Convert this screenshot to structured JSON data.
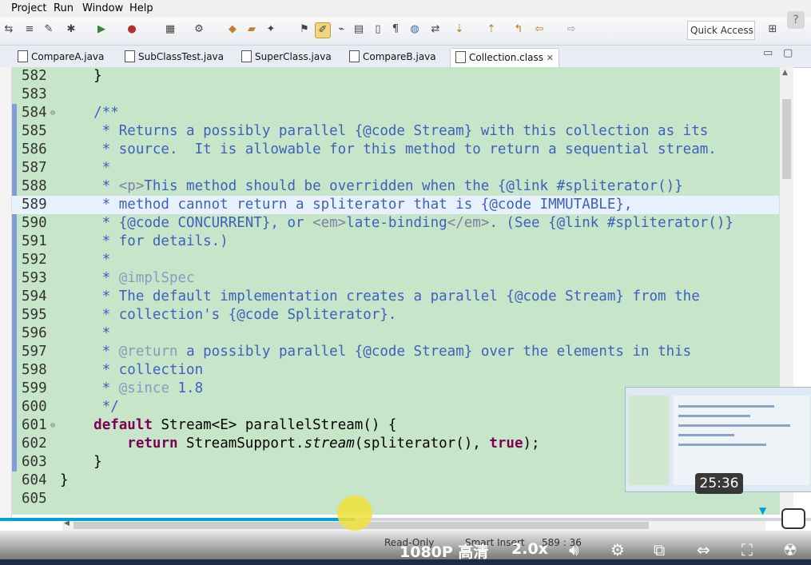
{
  "menu": {
    "items": [
      "Project",
      "Run",
      "Window",
      "Help"
    ]
  },
  "toolbar": {
    "quick_access": "Quick Access"
  },
  "tabs": [
    {
      "label": "CompareA.java"
    },
    {
      "label": "SubClassTest.java"
    },
    {
      "label": "SuperClass.java"
    },
    {
      "label": "CompareB.java"
    },
    {
      "label": "Collection.class",
      "active": true,
      "close": "✕"
    }
  ],
  "editor": {
    "highlighted_line": 589,
    "lines": [
      {
        "n": "582",
        "text": "    }"
      },
      {
        "n": "583",
        "text": ""
      },
      {
        "n": "584",
        "text": "    /**"
      },
      {
        "n": "585",
        "text": "     * Returns a possibly parallel {@code Stream} with this collection as its"
      },
      {
        "n": "586",
        "text": "     * source.  It is allowable for this method to return a sequential stream."
      },
      {
        "n": "587",
        "text": "     *"
      },
      {
        "n": "588",
        "text": "     * <p>This method should be overridden when the {@link #spliterator()}"
      },
      {
        "n": "589",
        "text": "     * method cannot return a spliterator that is {@code IMMUTABLE},"
      },
      {
        "n": "590",
        "text": "     * {@code CONCURRENT}, or <em>late-binding</em>. (See {@link #spliterator()}"
      },
      {
        "n": "591",
        "text": "     * for details.)"
      },
      {
        "n": "592",
        "text": "     *"
      },
      {
        "n": "593",
        "text": "     * @implSpec"
      },
      {
        "n": "594",
        "text": "     * The default implementation creates a parallel {@code Stream} from the"
      },
      {
        "n": "595",
        "text": "     * collection's {@code Spliterator}."
      },
      {
        "n": "596",
        "text": "     *"
      },
      {
        "n": "597",
        "text": "     * @return a possibly parallel {@code Stream} over the elements in this"
      },
      {
        "n": "598",
        "text": "     * collection"
      },
      {
        "n": "599",
        "text": "     * @since 1.8"
      },
      {
        "n": "600",
        "text": "     */"
      },
      {
        "n": "601",
        "text": "    default Stream<E> parallelStream() {"
      },
      {
        "n": "602",
        "text": "        return StreamSupport.stream(spliterator(), true);"
      },
      {
        "n": "603",
        "text": "    }"
      },
      {
        "n": "604",
        "text": "}"
      },
      {
        "n": "605",
        "text": ""
      }
    ]
  },
  "status": {
    "mode": "Read-Only",
    "insert": "Smart Insert",
    "position": "589 : 36"
  },
  "player": {
    "time": "25:36",
    "progress": 0.437,
    "quality": "1080P 高清",
    "speed": "2.0x"
  },
  "colors": {
    "editor_bg": "#c7e5c8",
    "comment": "#3f5fbf",
    "keyword": "#7f0055",
    "progress": "#00a1d6",
    "progress_knob": "#f2e23a"
  }
}
